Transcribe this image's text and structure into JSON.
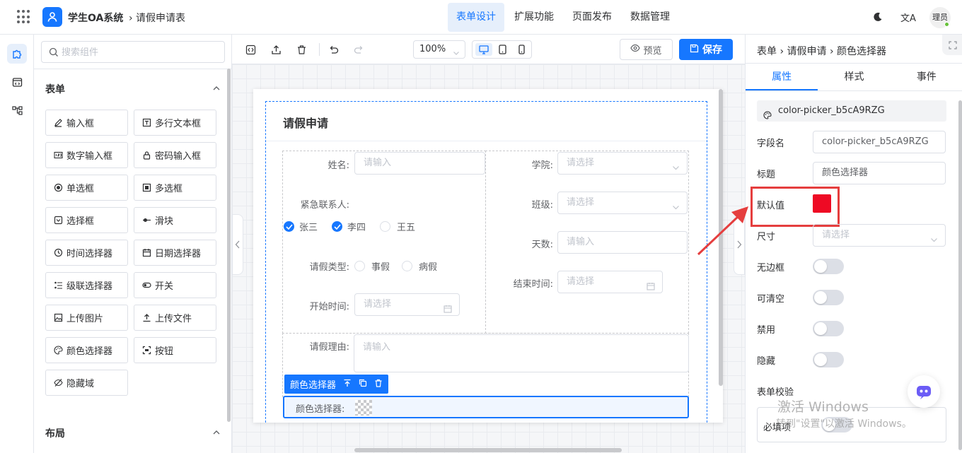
{
  "topbar": {
    "app_title": "学生OA系统",
    "breadcrumb": "› 请假申请表",
    "nav": [
      "表单设计",
      "扩展功能",
      "页面发布",
      "数据管理"
    ],
    "active_nav": "表单设计",
    "translate_glyph": "文A",
    "avatar_text": "理员"
  },
  "palette": {
    "search_placeholder": "搜索组件",
    "section_form": "表单",
    "components": [
      {
        "label": "输入框",
        "icon": "edit-icon"
      },
      {
        "label": "多行文本框",
        "icon": "textarea-icon"
      },
      {
        "label": "数字输入框",
        "icon": "number-icon"
      },
      {
        "label": "密码输入框",
        "icon": "lock-icon"
      },
      {
        "label": "单选框",
        "icon": "radio-icon"
      },
      {
        "label": "多选框",
        "icon": "checkbox-icon"
      },
      {
        "label": "选择框",
        "icon": "select-icon"
      },
      {
        "label": "滑块",
        "icon": "slider-icon"
      },
      {
        "label": "时间选择器",
        "icon": "clock-icon"
      },
      {
        "label": "日期选择器",
        "icon": "calendar-icon"
      },
      {
        "label": "级联选择器",
        "icon": "cascader-icon"
      },
      {
        "label": "开关",
        "icon": "switch-icon"
      },
      {
        "label": "上传图片",
        "icon": "image-icon"
      },
      {
        "label": "上传文件",
        "icon": "upload-icon"
      },
      {
        "label": "颜色选择器",
        "icon": "palette-icon"
      },
      {
        "label": "按钮",
        "icon": "button-icon"
      },
      {
        "label": "隐藏域",
        "icon": "eye-off-icon"
      }
    ],
    "section_layout": "布局"
  },
  "toolbar": {
    "zoom": "100%",
    "preview_label": "预览",
    "save_label": "保存"
  },
  "form": {
    "title": "请假申请",
    "name_label": "姓名:",
    "name_placeholder": "请输入",
    "contact_label": "紧急联系人:",
    "contacts": [
      {
        "label": "张三",
        "checked": true
      },
      {
        "label": "李四",
        "checked": true
      },
      {
        "label": "王五",
        "checked": false
      }
    ],
    "leave_type_label": "请假类型:",
    "leave_types": [
      "事假",
      "病假"
    ],
    "start_label": "开始时间:",
    "start_placeholder": "请选择",
    "college_label": "学院:",
    "college_placeholder": "请选择",
    "class_label": "班级:",
    "class_placeholder": "请选择",
    "days_label": "天数:",
    "days_placeholder": "请输入",
    "end_label": "结束时间:",
    "end_placeholder": "请选择",
    "reason_label": "请假理由:",
    "reason_placeholder": "请输入",
    "selected_tag": "颜色选择器",
    "color_field_label": "颜色选择器:"
  },
  "props": {
    "breadcrumb": [
      "表单",
      "请假申请",
      "颜色选择器"
    ],
    "tabs": [
      "属性",
      "样式",
      "事件"
    ],
    "active_tab": "属性",
    "component_id": "color-picker_b5cA9RZG",
    "field_name_label": "字段名",
    "field_name_value": "color-picker_b5cA9RZG",
    "title_label": "标题",
    "title_value": "颜色选择器",
    "default_label": "默认值",
    "default_color": "#ee0a24",
    "size_label": "尺寸",
    "size_placeholder": "请选择",
    "borderless_label": "无边框",
    "clearable_label": "可清空",
    "disabled_label": "禁用",
    "hidden_label": "隐藏",
    "validation_label": "表单校验",
    "required_label": "必填项"
  },
  "watermark": {
    "line1": "激活 Windows",
    "line2": "转到\"设置\"以激活 Windows。"
  },
  "colors": {
    "primary": "#1677ff",
    "annotation": "#e53e3e"
  }
}
